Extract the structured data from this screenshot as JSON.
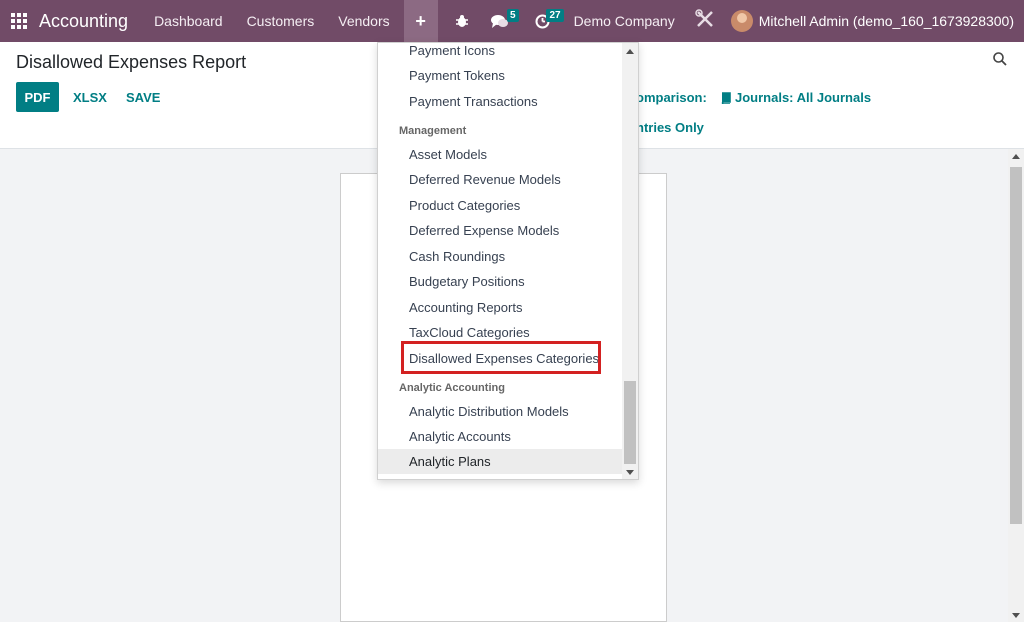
{
  "navbar": {
    "app_name": "Accounting",
    "menu": [
      "Dashboard",
      "Customers",
      "Vendors"
    ],
    "plus_label": "+",
    "messages_count": "5",
    "activities_count": "27",
    "company": "Demo Company",
    "user": "Mitchell Admin (demo_160_1673928300)",
    "bg_color": "#714b67"
  },
  "control_panel": {
    "title": "Disallowed Expenses Report",
    "pdf_label": "PDF",
    "xlsx_label": "XLSX",
    "save_label": "SAVE",
    "comparison_label": "omparison:",
    "journals_label": "Journals: All Journals",
    "entries_label": "ntries Only",
    "accent_color": "#017e84"
  },
  "dropdown": {
    "items": [
      {
        "type": "item",
        "label": "Payment Icons"
      },
      {
        "type": "item",
        "label": "Payment Tokens"
      },
      {
        "type": "item",
        "label": "Payment Transactions"
      },
      {
        "type": "header",
        "label": "Management"
      },
      {
        "type": "item",
        "label": "Asset Models"
      },
      {
        "type": "item",
        "label": "Deferred Revenue Models"
      },
      {
        "type": "item",
        "label": "Product Categories"
      },
      {
        "type": "item",
        "label": "Deferred Expense Models"
      },
      {
        "type": "item",
        "label": "Cash Roundings"
      },
      {
        "type": "item",
        "label": "Budgetary Positions"
      },
      {
        "type": "item",
        "label": "Accounting Reports"
      },
      {
        "type": "item",
        "label": "TaxCloud Categories"
      },
      {
        "type": "item",
        "label": "Disallowed Expenses Categories",
        "highlighted": true
      },
      {
        "type": "header",
        "label": "Analytic Accounting"
      },
      {
        "type": "item",
        "label": "Analytic Distribution Models"
      },
      {
        "type": "item",
        "label": "Analytic Accounts"
      },
      {
        "type": "item",
        "label": "Analytic Plans",
        "hovered": true
      }
    ],
    "highlight_color": "#d32121"
  }
}
